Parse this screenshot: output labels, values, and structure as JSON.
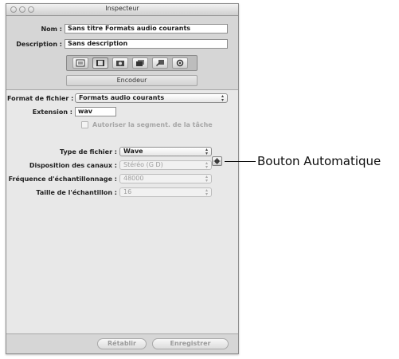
{
  "window": {
    "title": "Inspecteur"
  },
  "header": {
    "name_label": "Nom :",
    "name_value": "Sans titre Formats audio courants",
    "description_label": "Description :",
    "description_value": "Sans description"
  },
  "toolbar": {
    "icons": [
      "summary-icon",
      "film-icon",
      "camera-icon",
      "stack-icon",
      "actions-icon",
      "gear-icon"
    ],
    "active_tab": "Encodeur"
  },
  "form": {
    "file_format_label": "Format de fichier :",
    "file_format_value": "Formats audio courants",
    "extension_label": "Extension :",
    "extension_value": "wav",
    "allow_segment_label": "Autoriser la segment. de la tâche",
    "file_type_label": "Type de fichier :",
    "file_type_value": "Wave",
    "channel_layout_label": "Disposition des canaux :",
    "channel_layout_value": "Stéréo (G D)",
    "sample_rate_label": "Fréquence d'échantillonnage :",
    "sample_rate_value": "48000",
    "sample_size_label": "Taille de l'échantillon :",
    "sample_size_value": "16"
  },
  "footer": {
    "revert_label": "Rétablir",
    "save_label": "Enregistrer"
  },
  "annotation": {
    "text": "Bouton Automatique"
  }
}
